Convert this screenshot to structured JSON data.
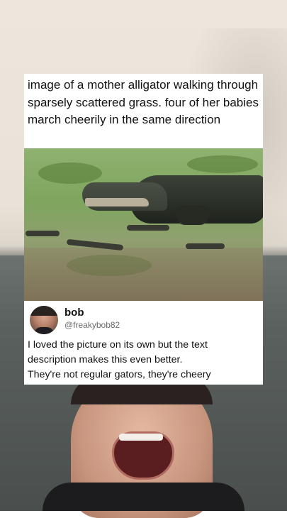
{
  "post": {
    "caption": "image of a mother alligator walking through sparsely scattered grass. four of her babies march cheerily in the same direction"
  },
  "reply": {
    "name": "bob",
    "handle": "@freakybob82",
    "text_line1": "I loved the picture on its own but the text",
    "text_line2": "description makes this even better.",
    "text_line3": "They're not regular gators, they're cheery"
  },
  "colors": {
    "card_background": "#ffffff",
    "handle_gray": "#6b6b6b"
  }
}
